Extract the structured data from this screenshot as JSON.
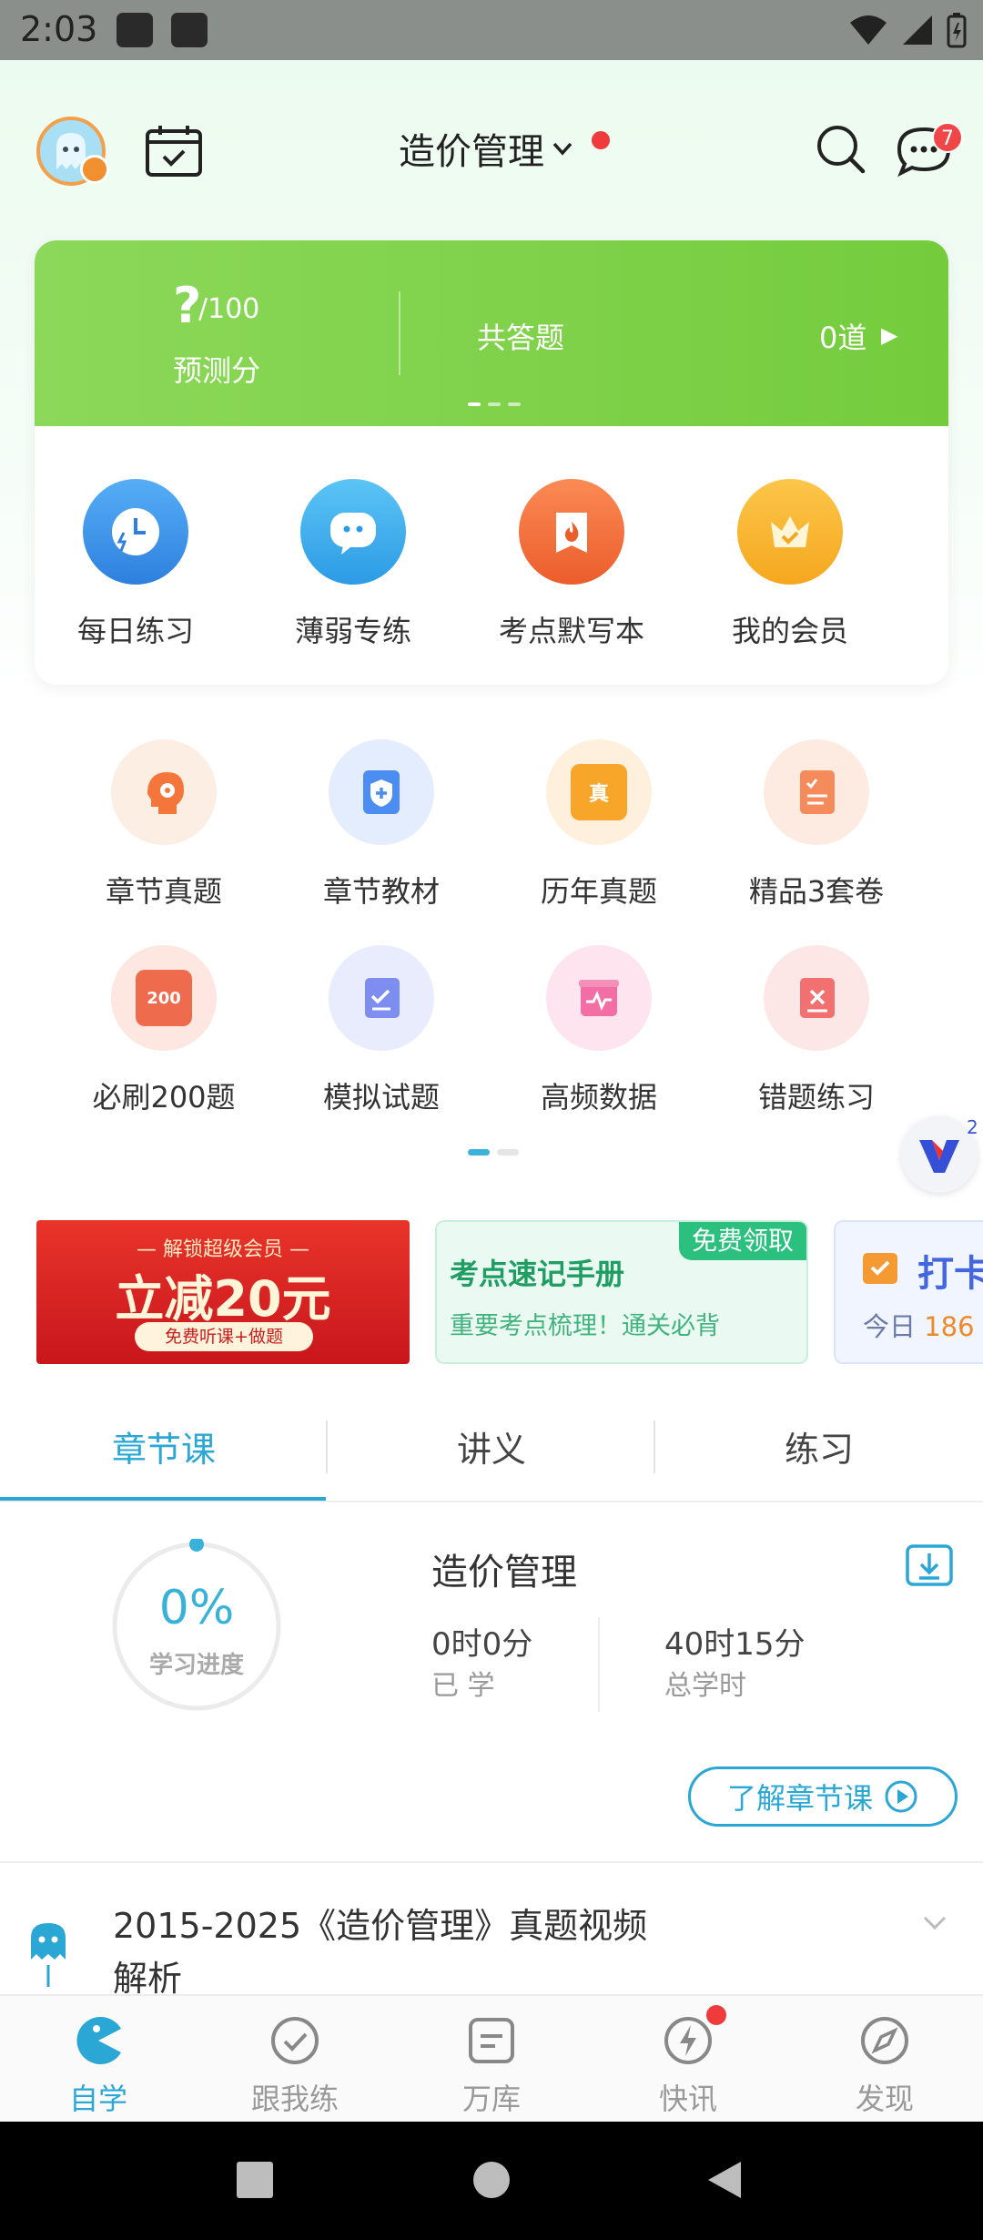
{
  "status_bar": {
    "time": "2:03"
  },
  "header": {
    "course_title": "造价管理",
    "message_count": "7"
  },
  "score_card": {
    "score_symbol": "?",
    "score_max": "/100",
    "score_label": "预测分",
    "total_label": "共答题",
    "total_value": "0道"
  },
  "quick_actions": [
    {
      "label": "每日练习",
      "icon": "clock-lightning-icon",
      "color": "#3a93e8"
    },
    {
      "label": "薄弱专练",
      "icon": "chat-bubble-icon",
      "color": "#3aa9ec"
    },
    {
      "label": "考点默写本",
      "icon": "flame-book-icon",
      "color": "#f0693a"
    },
    {
      "label": "我的会员",
      "icon": "crown-icon",
      "color": "#f7b32b"
    }
  ],
  "grid": [
    {
      "label": "章节真题",
      "icon": "gear-head-icon",
      "tile_text": ""
    },
    {
      "label": "章节教材",
      "icon": "shield-plus-icon",
      "tile_text": ""
    },
    {
      "label": "历年真题",
      "icon": "folder-zhen-icon",
      "tile_text": "真"
    },
    {
      "label": "精品3套卷",
      "icon": "document-check-icon",
      "tile_text": ""
    },
    {
      "label": "必刷200题",
      "icon": "paper-200-icon",
      "tile_text": "200"
    },
    {
      "label": "模拟试题",
      "icon": "test-paper-icon",
      "tile_text": ""
    },
    {
      "label": "高频数据",
      "icon": "chart-pulse-icon",
      "tile_text": ""
    },
    {
      "label": "错题练习",
      "icon": "wrong-x-icon",
      "tile_text": ""
    }
  ],
  "float_badge": {
    "count": "2"
  },
  "banners": {
    "member": {
      "line1": "— 解锁超级会员 —",
      "line2": "立减20元",
      "line3": "免费听课+做题"
    },
    "handbook": {
      "tag": "免费领取",
      "title": "考点速记手册",
      "subtitle": "重要考点梳理！通关必背"
    },
    "checkin": {
      "title": "打卡",
      "subtitle_prefix": "今日",
      "subtitle_count": "186"
    }
  },
  "tabs": [
    {
      "label": "章节课"
    },
    {
      "label": "讲义"
    },
    {
      "label": "练习"
    }
  ],
  "progress": {
    "percent_text": "0%",
    "percent_value": 0,
    "label": "学习进度",
    "course_name": "造价管理",
    "learned_value": "0时0分",
    "learned_label": "已 学",
    "total_value": "40时15分",
    "total_label": "总学时",
    "learn_button": "了解章节课"
  },
  "video_item": {
    "title": "2015-2025《造价管理》真题视频解析"
  },
  "bottom_nav": [
    {
      "label": "自学",
      "icon": "pacman-icon"
    },
    {
      "label": "跟我练",
      "icon": "check-circle-icon"
    },
    {
      "label": "万库",
      "icon": "document-list-icon"
    },
    {
      "label": "快讯",
      "icon": "lightning-icon"
    },
    {
      "label": "发现",
      "icon": "compass-icon"
    }
  ],
  "colors": {
    "accent": "#2aa7d4",
    "green": "#74cc3c",
    "badge_red": "#ef3b3b"
  }
}
